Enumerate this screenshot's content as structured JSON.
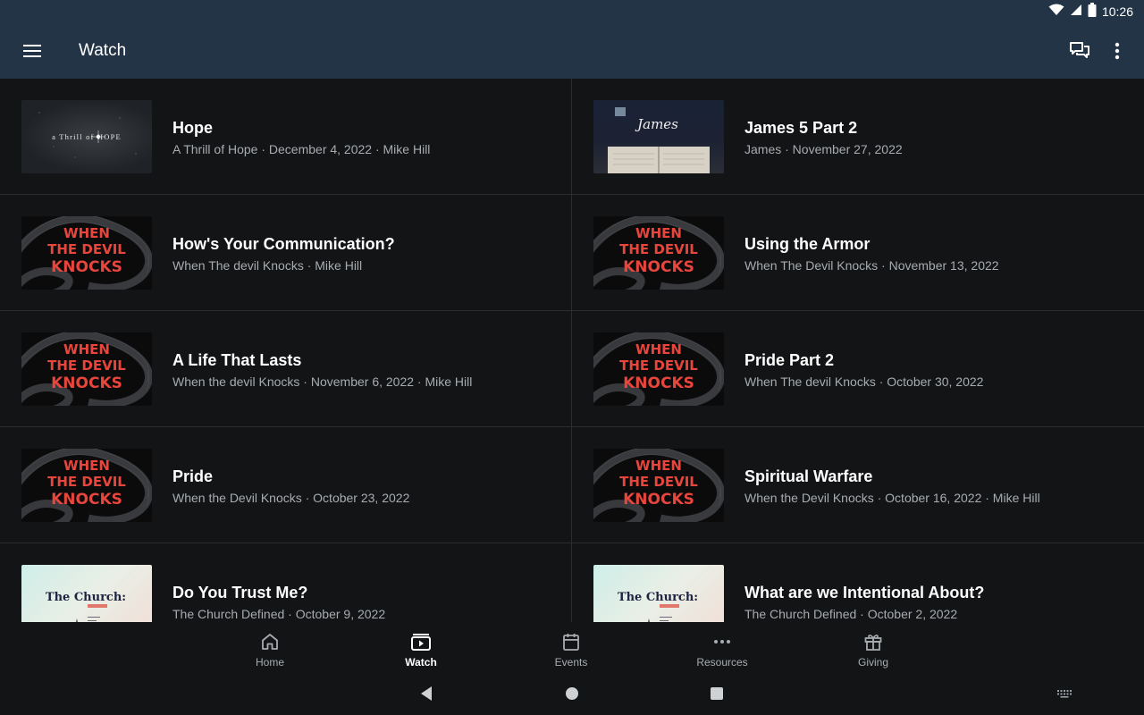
{
  "status": {
    "time": "10:26",
    "icons": [
      "wifi-icon",
      "signal-icon",
      "battery-icon"
    ]
  },
  "app_bar": {
    "title": "Watch",
    "menu_icon": "menu-icon",
    "chat_icon": "chat-icon",
    "more_icon": "more-vert-icon"
  },
  "items": [
    {
      "title": "Hope",
      "subtitle": "A Thrill of Hope · December 4, 2022 · Mike Hill",
      "thumb": "hope",
      "thumb_text": "a Thrill of HOPE"
    },
    {
      "title": "James 5 Part 2",
      "subtitle": "James · November 27, 2022",
      "thumb": "james",
      "thumb_text": "James"
    },
    {
      "title": "How's Your Communication?",
      "subtitle": "When The devil Knocks · Mike Hill",
      "thumb": "devil",
      "thumb_text": "WHEN THE DEVIL KNOCKS"
    },
    {
      "title": "Using the Armor",
      "subtitle": "When The Devil Knocks · November 13, 2022",
      "thumb": "devil",
      "thumb_text": "WHEN THE DEVIL KNOCKS"
    },
    {
      "title": "A Life That Lasts",
      "subtitle": "When the devil Knocks · November 6, 2022 · Mike Hill",
      "thumb": "devil",
      "thumb_text": "WHEN THE DEVIL KNOCKS"
    },
    {
      "title": "Pride Part 2",
      "subtitle": "When The devil Knocks · October 30, 2022",
      "thumb": "devil",
      "thumb_text": "WHEN THE DEVIL KNOCKS"
    },
    {
      "title": "Pride",
      "subtitle": "When the Devil Knocks · October 23, 2022",
      "thumb": "devil",
      "thumb_text": "WHEN THE DEVIL KNOCKS"
    },
    {
      "title": "Spiritual Warfare",
      "subtitle": "When the Devil Knocks · October 16, 2022 · Mike Hill",
      "thumb": "devil",
      "thumb_text": "WHEN THE DEVIL KNOCKS"
    },
    {
      "title": "Do You Trust Me?",
      "subtitle": "The Church Defined · October 9, 2022",
      "thumb": "church",
      "thumb_text": "The Church:"
    },
    {
      "title": "What are we Intentional About?",
      "subtitle": "The Church Defined · October 2, 2022",
      "thumb": "church",
      "thumb_text": "The Church:"
    }
  ],
  "bottom_nav": [
    {
      "label": "Home",
      "icon": "home-icon",
      "active": false
    },
    {
      "label": "Watch",
      "icon": "watch-icon",
      "active": true
    },
    {
      "label": "Events",
      "icon": "calendar-icon",
      "active": false
    },
    {
      "label": "Resources",
      "icon": "more-horiz-icon",
      "active": false
    },
    {
      "label": "Giving",
      "icon": "gift-icon",
      "active": false
    }
  ],
  "colors": {
    "app_bar": "#243447",
    "background": "#121416",
    "devil_red": "#e8453c",
    "subtitle": "#a8acb0"
  }
}
